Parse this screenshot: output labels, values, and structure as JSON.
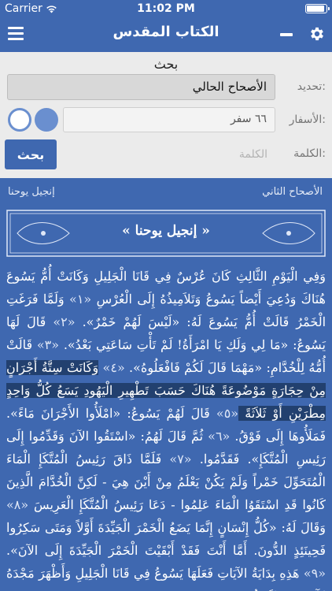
{
  "status_bar": {
    "carrier": "Carrier",
    "time": "11:02 PM",
    "battery_level": 0.95
  },
  "nav": {
    "title": "الكتاب المقدس",
    "menu_icon": "hamburger-menu-icon",
    "minus_icon": "minus-icon",
    "settings_icon": "gear-icon",
    "bar_color": "#3f68b0"
  },
  "search": {
    "title": "بحث",
    "scope_label": "تحديد:",
    "scope_value": "الأصحاح الحالي",
    "books_label": "الأسفار:",
    "books_value": "٦٦ سفر",
    "word_label": "الكلمة:",
    "word_placeholder": "الكلمة",
    "search_button": "بحث"
  },
  "reader": {
    "chapter_label": "الأصحاح الثاني",
    "book_label": "إنجيل يوحنا",
    "banner_title": "« إنجيل يوحنا »",
    "verses": [
      {
        "n": "",
        "text": "وَفِي الْيَوْمِ الثَّالِثِ كَانَ عُرْسٌ فِي قَانَا الْجَلِيلِ وَكَانَتْ أُمُّ يَسُوعَ هُنَاكَ"
      },
      {
        "n": "«١»",
        "text": "وَدُعِيَ أَيْضاً يَسُوعُ وَتَلاَمِيذُهُ إِلَى الْعُرْسِ"
      },
      {
        "n": "«٢»",
        "text": "وَلَمَّا فَرَغَتِ الْخَمْرُ قَالَتْ أُمُّ يَسُوعَ لَهُ: «لَيْسَ لَهُمْ خَمْرٌ»."
      },
      {
        "n": "«٣»",
        "text": "قَالَ لَهَا يَسُوعُ: «مَا لِي وَلَكِ يَا امْرَأَةُ! لَمْ تَأْتِ سَاعَتِي بَعْدُ»."
      },
      {
        "n": "«٤»",
        "text": "قَالَتْ أُمُّهُ لِلْخُدَّامِ: «مَهْمَا قَالَ لَكُمْ فَافْعَلُوهُ»."
      },
      {
        "n": "«٥»",
        "text": "وَكَانَتْ سِتَّةُ أَجْرَانٍ مِنْ حِجَارَةٍ مَوْضُوعَةً هُنَاكَ حَسَبَ تَطْهِيرِ الْيَهُودِ يَسَعُ كُلُّ وَاحِدٍ مِطْرَيْنِ أَوْ ثَلاَثَةً",
        "highlight": true
      },
      {
        "n": "«٦»",
        "text": "قَالَ لَهُمْ يَسُوعُ: «امْلَأُوا الأَجْرَانَ مَاءً». فَمَلَأُوهَا إِلَى فَوْقُ."
      },
      {
        "n": "«٧»",
        "text": "ثُمَّ قَالَ لَهُمُ: «اسْتَقُوا الآنَ وَقَدِّمُوا إِلَى رَئِيسِ الْمُتَّكَإِ». فَقَدَّمُوا."
      },
      {
        "n": "«٨»",
        "text": "فَلَمَّا ذَاقَ رَئِيسُ الْمُتَّكَإِ الْمَاءَ الْمُتَحَوِّلَ خَمْراً وَلَمْ يَكُنْ يَعْلَمُ مِنْ أَيْنَ هِيَ - لَكِنَّ الْخُدَّامَ الَّذِينَ كَانُوا قَدِ اسْتَقَوُا الْمَاءَ عَلِمُوا - دَعَا رَئِيسُ الْمُتَّكَإِ الْعَرِيسَ"
      },
      {
        "n": "«٩»",
        "text": "وَقَالَ لَهُ: «كُلُّ إِنْسَانٍ إِنَّمَا يَضَعُ الْخَمْرَ الْجَيِّدَةَ أَوَّلاً وَمَتَى سَكِرُوا فَحِينَئِذٍ الدُّونَ. أَمَّا أَنْتَ فَقَدْ أَبْقَيْتَ الْخَمْرَ الْجَيِّدَةَ إِلَى الآنَ»."
      },
      {
        "n": "«١٠»",
        "text": "هَذِهِ بِدَايَةُ الآيَاتِ فَعَلَهَا يَسُوعُ فِي قَانَا الْجَلِيلِ وَأَظْهَرَ مَجْدَهُ فَآمَنَ بِهِ تَلاَمِيذُهُ"
      }
    ]
  }
}
